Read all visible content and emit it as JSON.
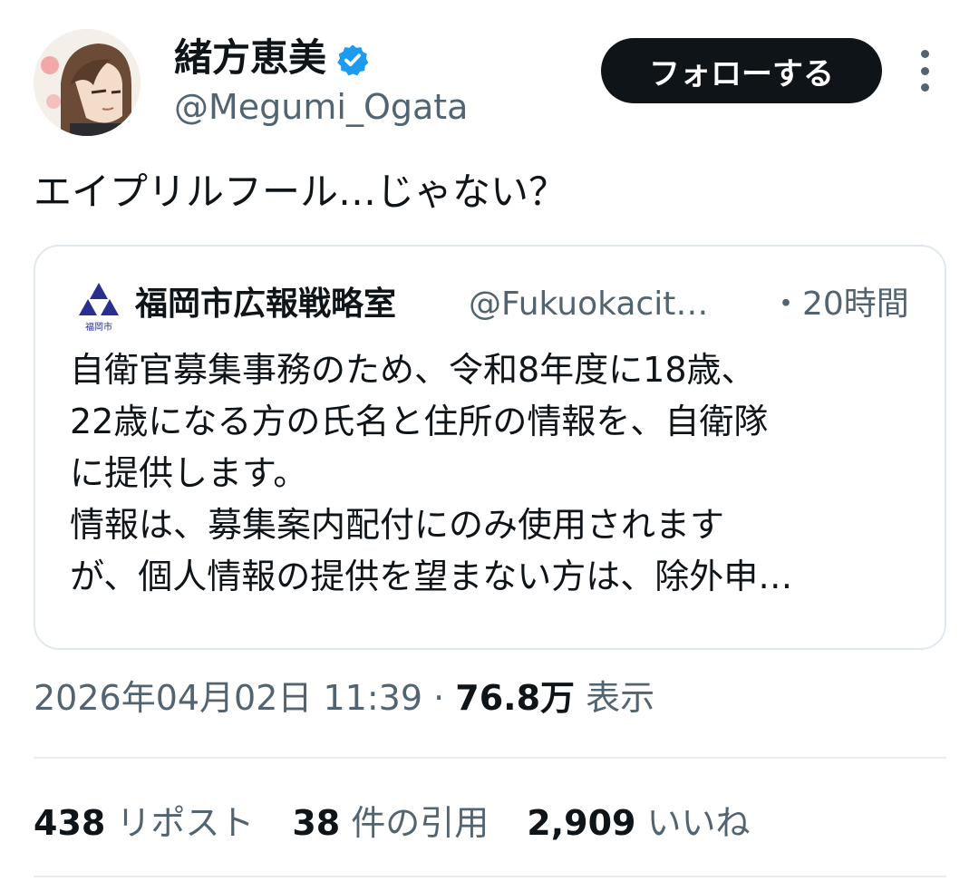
{
  "author": {
    "name": "緒方恵美",
    "handle": "@Megumi_Ogata",
    "verified_color": "#1d9bf0"
  },
  "follow_label": "フォローする",
  "tweet_text": "エイプリルフール…じゃない？",
  "quote": {
    "name": "福岡市広報戦略室",
    "handle": "@Fukuokacit…",
    "time": "・20時間",
    "logo_caption": "福岡市",
    "lines": [
      "自衛官募集事務のため、令和8年度に18歳、",
      "22歳になる方の氏名と住所の情報を、自衛隊",
      "に提供します。",
      "情報は、募集案内配付にのみ使用されます",
      "が、個人情報の提供を望まない方は、除外申…"
    ]
  },
  "meta": {
    "timestamp": "2026年04月02日 11:39",
    "separator": "·",
    "views": "76.8万",
    "views_label": "表示"
  },
  "stats": {
    "reposts": "438",
    "reposts_label": "リポスト",
    "quotes": "38",
    "quotes_label": "件の引用",
    "likes": "2,909",
    "likes_label": "いいね"
  },
  "colors": {
    "text": "#0f1419",
    "secondary": "#536471",
    "border": "#e1e8ed",
    "logo": "#2a2f8f"
  },
  "icons": {
    "verified": "verified-badge-icon",
    "more": "more-vertical-icon",
    "logo": "fukuoka-city-emblem-icon"
  }
}
